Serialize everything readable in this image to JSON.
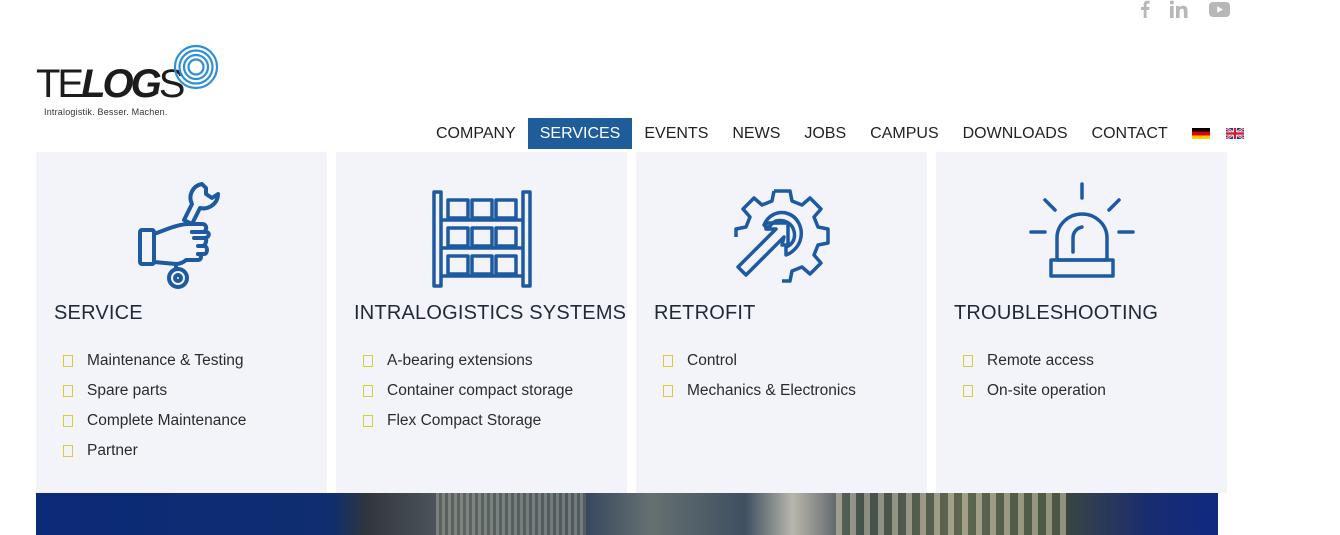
{
  "social": {
    "icons": [
      "facebook-icon",
      "linkedin-icon",
      "youtube-icon"
    ]
  },
  "logo": {
    "wordmark_te": "TE",
    "wordmark_log": "LOG",
    "wordmark_s": "S",
    "tagline": "Intralogistik. Besser. Machen."
  },
  "nav": {
    "items": [
      {
        "label": "COMPANY"
      },
      {
        "label": "SERVICES",
        "active": true
      },
      {
        "label": "EVENTS"
      },
      {
        "label": "NEWS"
      },
      {
        "label": "JOBS"
      },
      {
        "label": "CAMPUS"
      },
      {
        "label": "DOWNLOADS"
      },
      {
        "label": "CONTACT"
      }
    ],
    "flags": [
      "german-flag-icon",
      "uk-flag-icon"
    ]
  },
  "colors": {
    "accent": "#1f5c9a",
    "icon_blue": "#1e5aa0",
    "menu_bg": "#f2f4f9",
    "bullet": "#d6cf3a"
  },
  "menu": {
    "columns": [
      {
        "title": "SERVICE",
        "icon": "wrench-hand-icon",
        "items": [
          "Maintenance & Testing",
          "Spare parts",
          "Complete Maintenance",
          "Partner"
        ]
      },
      {
        "title": "INTRALOGISTICS SYSTEMS",
        "icon": "shelving-rack-icon",
        "items": [
          "A-bearing extensions",
          "Container compact storage",
          "Flex Compact Storage"
        ]
      },
      {
        "title": "RETROFIT",
        "icon": "gear-arrow-icon",
        "items": [
          "Control",
          "Mechanics & Electronics"
        ]
      },
      {
        "title": "TROUBLESHOOTING",
        "icon": "siren-icon",
        "items": [
          "Remote access",
          "On-site operation"
        ]
      }
    ]
  }
}
